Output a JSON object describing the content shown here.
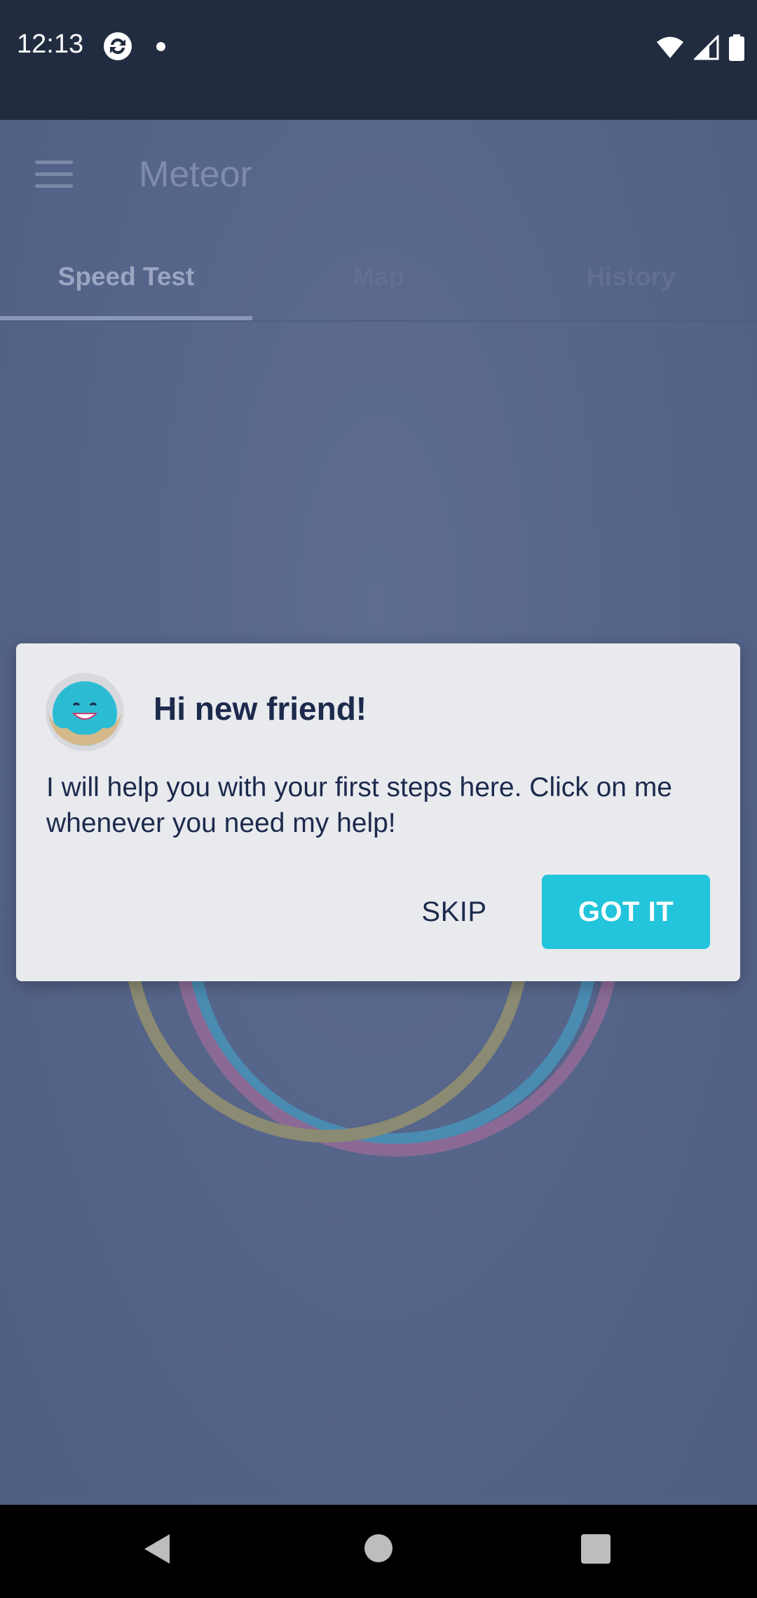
{
  "status_bar": {
    "time": "12:13",
    "icons": [
      "sync-icon",
      "notification-dot-icon",
      "wifi-icon",
      "signal-icon",
      "battery-icon"
    ]
  },
  "app": {
    "title": "Meteor",
    "tabs": [
      {
        "label": "Speed Test",
        "active": true
      },
      {
        "label": "Map",
        "active": false
      },
      {
        "label": "History",
        "active": false
      }
    ]
  },
  "dialog": {
    "title": "Hi new friend!",
    "body": "I will help you with your first steps here. Click on me whenever you need my help!",
    "skip_label": "SKIP",
    "got_it_label": "GOT IT"
  },
  "colors": {
    "status_bar": "#222c40",
    "app_background": "#56658a",
    "dialog_background": "#e8eaee",
    "primary_button": "#22c5db",
    "text_dark": "#1c2a4c",
    "ring_yellow": "#8b8a72",
    "ring_pink": "#8a6a95",
    "ring_blue": "#4a8bb2"
  }
}
